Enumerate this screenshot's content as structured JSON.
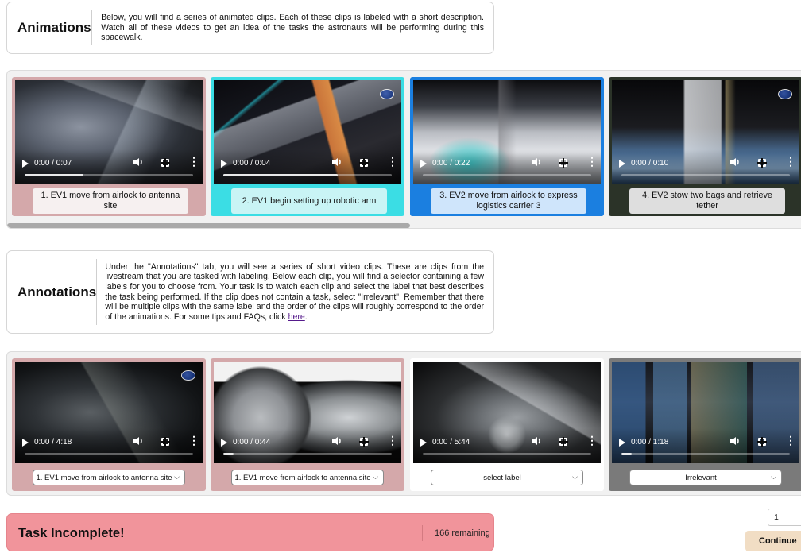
{
  "animations_card": {
    "heading": "Animations",
    "description": "Below, you will find a series of animated clips. Each of these clips is labeled with a short description. Watch all of these videos to get an idea of the tasks the astronauts will be performing during this spacewalk."
  },
  "animations": [
    {
      "time": "0:00 / 0:07",
      "progress": 0.35,
      "label": "1. EV1 move from airlock to antenna site",
      "color": "#d4a8aa",
      "label_bg": "#f6f0f0"
    },
    {
      "time": "0:00 / 0:04",
      "progress": 0.68,
      "label": "2. EV1 begin setting up robotic arm",
      "color": "#3bdde4",
      "label_bg": "#c9f4f5"
    },
    {
      "time": "0:00 / 0:22",
      "progress": 0.0,
      "label": "3. EV2 move from airlock to express logistics carrier 3",
      "color": "#1b7fe0",
      "label_bg": "#cfe5fb"
    },
    {
      "time": "0:00 / 0:10",
      "progress": 0.0,
      "label": "4. EV2 stow two bags and retrieve tether",
      "color": "#2b3328",
      "label_bg": "#dedede"
    }
  ],
  "annotations_card": {
    "heading": "Annotations",
    "description_pre": "Under the \"Annotations\" tab, you will see a series of short video clips. These are clips from the livestream that you are tasked with labeling. Below each clip, you will find a selector containing a few labels for you to choose from. Your task is to watch each clip and select the label that best describes the task being performed. If the clip does not contain a task, select \"Irrelevant\". Remember that there will be multiple clips with the same label and the order of the clips will roughly correspond to the order of the animations. For some tips and FAQs, click ",
    "link_text": "here",
    "description_post": "."
  },
  "annotation_clips": [
    {
      "time": "0:00 / 4:18",
      "progress": 0.0,
      "selected": "1. EV1 move from airlock to antenna site",
      "color": "#d4a8aa"
    },
    {
      "time": "0:00 / 0:44",
      "progress": 0.06,
      "selected": "1. EV1 move from airlock to antenna site",
      "color": "#d4a8aa"
    },
    {
      "time": "0:00 / 5:44",
      "progress": 0.0,
      "selected": "select label",
      "color": "#ffffff"
    },
    {
      "time": "0:00 / 1:18",
      "progress": 0.06,
      "selected": "Irrelevant",
      "color": "#7a7a7a"
    }
  ],
  "status": {
    "title": "Task Incomplete!",
    "remaining": "166 remaining",
    "color": "#f1949b"
  },
  "pager": {
    "value": "1"
  },
  "continue_label": "Continue",
  "icons": {
    "play": "play-icon",
    "volume": "volume-icon",
    "fullscreen": "fullscreen-icon",
    "more": "more-vertical-icon",
    "logo": "nasa-logo-icon",
    "chevron": "chevron-down-icon"
  }
}
